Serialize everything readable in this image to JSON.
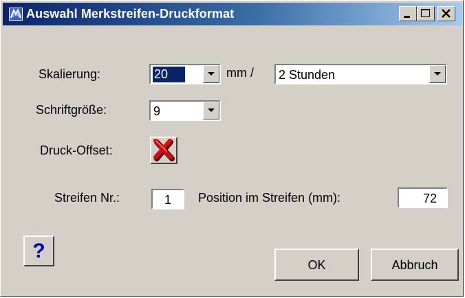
{
  "window": {
    "title": "Auswahl Merkstreifen-Druckformat",
    "controls": [
      "minimize",
      "maximize",
      "close"
    ]
  },
  "scaling": {
    "label": "Skalierung:",
    "value": "20",
    "unit_separator": "mm /",
    "period_value": "2 Stunden"
  },
  "font_size": {
    "label": "Schriftgröße:",
    "value": "9"
  },
  "print_offset": {
    "label": "Druck-Offset:",
    "icon": "red-x-icon"
  },
  "strip": {
    "number_label": "Streifen Nr.:",
    "number_value": "1",
    "position_label": "Position im Streifen (mm):",
    "position_value": "72"
  },
  "buttons": {
    "help_label": "?",
    "ok_label": "OK",
    "cancel_label": "Abbruch"
  },
  "colors": {
    "title_bar": "#0a246a",
    "face": "#d4d0c8",
    "selection": "#0a246a",
    "help_mark": "#0000cc",
    "x_mark": "#c00000"
  }
}
